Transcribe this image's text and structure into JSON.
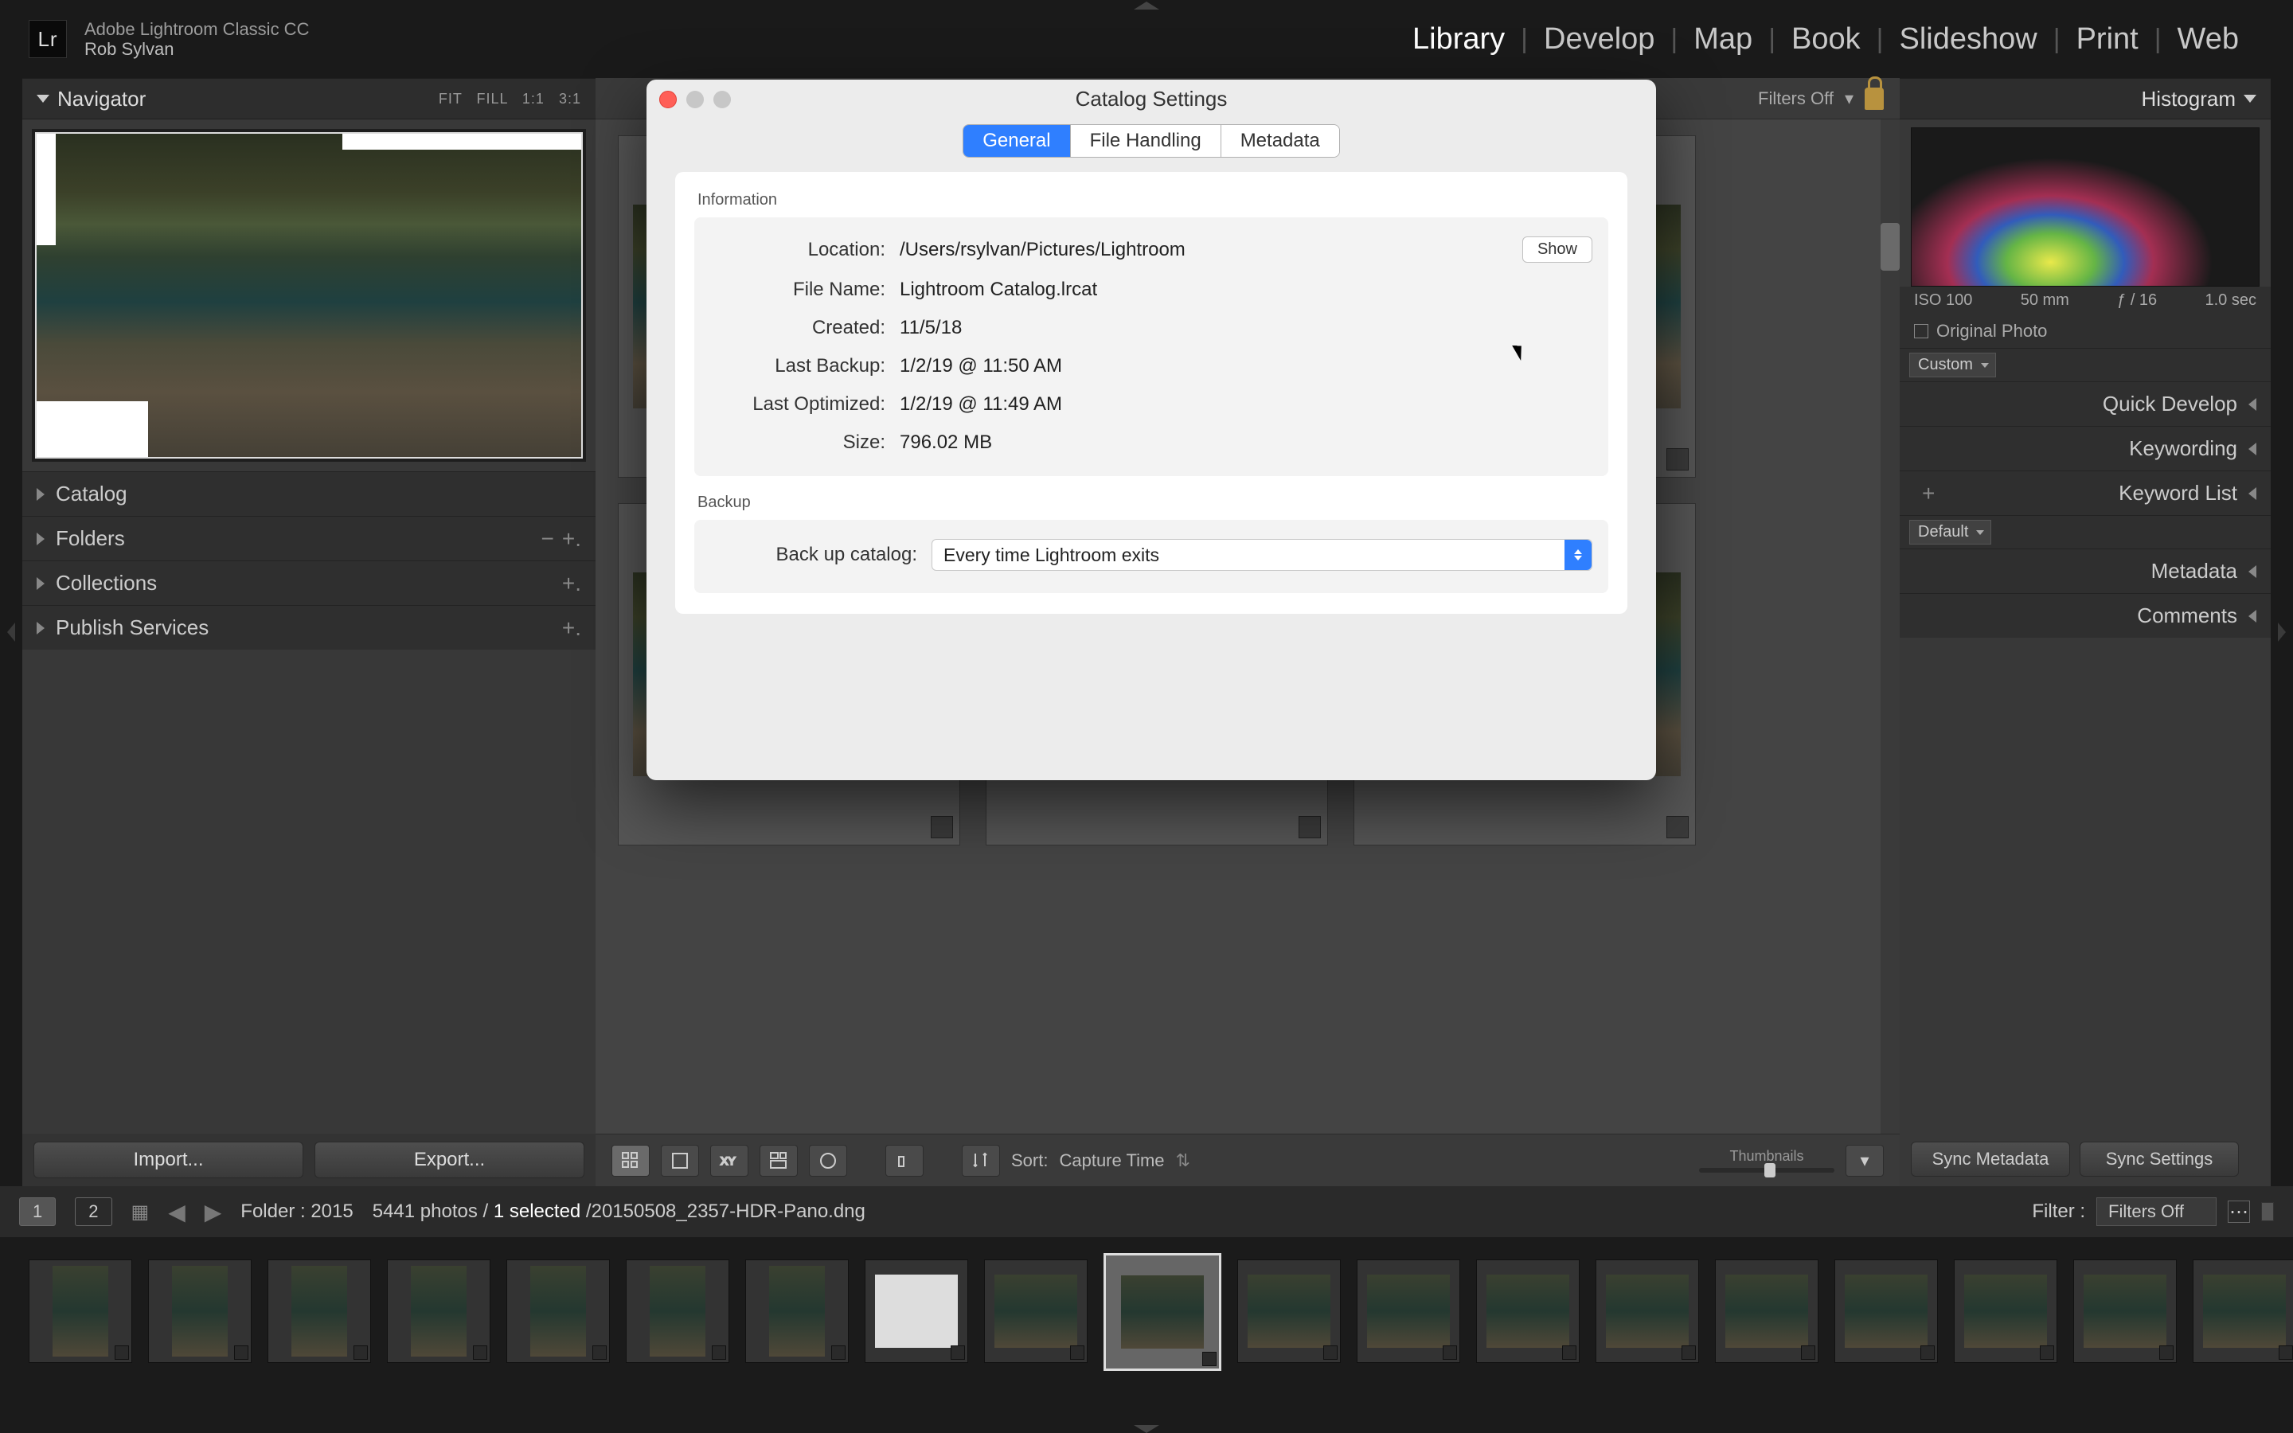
{
  "app": {
    "product": "Adobe Lightroom Classic CC",
    "user": "Rob Sylvan",
    "logo": "Lr"
  },
  "modules": {
    "items": [
      "Library",
      "Develop",
      "Map",
      "Book",
      "Slideshow",
      "Print",
      "Web"
    ],
    "active": "Library"
  },
  "left": {
    "navigator": {
      "title": "Navigator",
      "zoom": [
        "FIT",
        "FILL",
        "1:1",
        "3:1"
      ]
    },
    "sections": [
      {
        "label": "Catalog"
      },
      {
        "label": "Folders"
      },
      {
        "label": "Collections"
      },
      {
        "label": "Publish Services"
      }
    ],
    "buttons": {
      "import": "Import...",
      "export": "Export..."
    }
  },
  "right": {
    "histogram": {
      "title": "Histogram"
    },
    "readout": {
      "iso": "ISO 100",
      "focal": "50 mm",
      "aperture": "ƒ / 16",
      "shutter": "1.0 sec"
    },
    "original": "Original Photo",
    "quick_dd": "Custom",
    "sections": [
      {
        "label": "Quick Develop"
      },
      {
        "label": "Keywording"
      },
      {
        "label": "Keyword List"
      },
      {
        "label": "Metadata"
      },
      {
        "label": "Comments"
      }
    ],
    "meta_dd": "Default",
    "sync": {
      "meta": "Sync Metadata",
      "settings": "Sync Settings"
    }
  },
  "filters": {
    "off": "Filters Off"
  },
  "toolbar": {
    "sort_label": "Sort:",
    "sort_value": "Capture Time",
    "thumbnails": "Thumbnails"
  },
  "status": {
    "primary": "1",
    "secondary": "2",
    "folder_label": "Folder :",
    "folder_value": "2015",
    "count": "5441 photos",
    "selected": "1 selected",
    "filename": "20150508_2357-HDR-Pano.dng",
    "filter_label": "Filter :",
    "filter_value": "Filters Off"
  },
  "dialog": {
    "title": "Catalog Settings",
    "tabs": [
      "General",
      "File Handling",
      "Metadata"
    ],
    "active_tab": "General",
    "info_title": "Information",
    "backup_title": "Backup",
    "show": "Show",
    "rows": {
      "location_l": "Location:",
      "location_v": "/Users/rsylvan/Pictures/Lightroom",
      "file_l": "File Name:",
      "file_v": "Lightroom Catalog.lrcat",
      "created_l": "Created:",
      "created_v": "11/5/18",
      "backup_l": "Last Backup:",
      "backup_v": "1/2/19 @ 11:50 AM",
      "opt_l": "Last Optimized:",
      "opt_v": "1/2/19 @ 11:49 AM",
      "size_l": "Size:",
      "size_v": "796.02 MB"
    },
    "backup_row_l": "Back up catalog:",
    "backup_row_v": "Every time Lightroom exits"
  }
}
